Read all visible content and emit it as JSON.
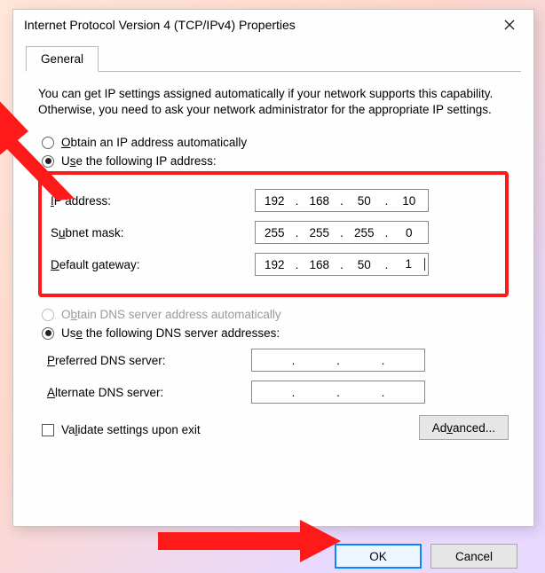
{
  "window": {
    "title": "Internet Protocol Version 4 (TCP/IPv4) Properties"
  },
  "tabs": {
    "general": "General"
  },
  "help": "You can get IP settings assigned automatically if your network supports this capability. Otherwise, you need to ask your network administrator for the appropriate IP settings.",
  "ip": {
    "auto_label": "Obtain an IP address automatically",
    "manual_label": "Use the following IP address:",
    "ip_label": "IP address:",
    "subnet_label": "Subnet mask:",
    "gateway_label": "Default gateway:",
    "ip": [
      "192",
      "168",
      "50",
      "10"
    ],
    "subnet": [
      "255",
      "255",
      "255",
      "0"
    ],
    "gateway": [
      "192",
      "168",
      "50",
      "1"
    ]
  },
  "dns": {
    "auto_label": "Obtain DNS server address automatically",
    "manual_label": "Use the following DNS server addresses:",
    "preferred_label": "Preferred DNS server:",
    "alternate_label": "Alternate DNS server:",
    "preferred": [
      "",
      "",
      "",
      ""
    ],
    "alternate": [
      "",
      "",
      "",
      ""
    ]
  },
  "validate_label": "Validate settings upon exit",
  "advanced_label": "Advanced...",
  "ok_label": "OK",
  "cancel_label": "Cancel"
}
